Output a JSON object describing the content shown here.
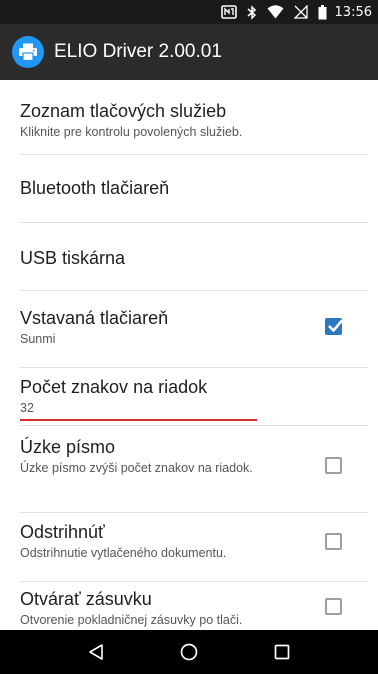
{
  "status_bar": {
    "time": "13:56",
    "icons": [
      "nfc-icon",
      "bluetooth-icon",
      "wifi-icon",
      "signal-icon",
      "battery-icon"
    ]
  },
  "app_bar": {
    "title": "ELIO Driver 2.00.01",
    "icon": "printer-icon",
    "accent_color": "#2196f3"
  },
  "settings": {
    "print_services": {
      "title": "Zoznam tlačových služieb",
      "summary": "Kliknite pre kontrolu povolených služieb."
    },
    "bluetooth": {
      "title": "Bluetooth tlačiareň"
    },
    "usb": {
      "title": "USB tiskárna"
    },
    "builtin": {
      "title": "Vstavaná tlačiareň",
      "summary": "Sunmi",
      "checked": true
    },
    "chars_per_line": {
      "title": "Počet znakov na riadok",
      "value": "32"
    },
    "narrow_font": {
      "title": "Úzke písmo",
      "summary": "Úzke písmo zvýši počet znakov na riadok.",
      "checked": false
    },
    "cut": {
      "title": "Odstrihnúť",
      "summary": "Odstrihnutie vytlačeného dokumentu.",
      "checked": false
    },
    "drawer": {
      "title": "Otvárať zásuvku",
      "summary": "Otvorenie pokladničnej zásuvky po tlači.",
      "checked": false
    }
  },
  "nav_bar": {
    "buttons": [
      "back-icon",
      "home-icon",
      "recents-icon"
    ]
  },
  "colors": {
    "checkbox_checked": "#2b78c2",
    "edit_underline": "#d32f2f"
  }
}
